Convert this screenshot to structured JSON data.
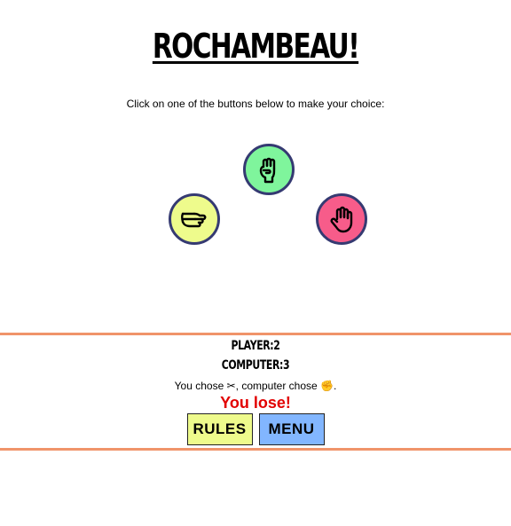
{
  "header": {
    "title": "ROCHAMBEAU!",
    "instruction": "Click on one of the buttons below to make your choice:"
  },
  "choices": {
    "rock": {
      "icon": "fist-icon",
      "color": "#7ff59c"
    },
    "scissors": {
      "icon": "scissors-hand-icon",
      "color": "#eefb8c"
    },
    "paper": {
      "icon": "open-hand-icon",
      "color": "#f75c8a"
    },
    "border_color": "#353a72"
  },
  "scoreboard": {
    "player": "PLAYER:2",
    "computer": "COMPUTER:3",
    "result_prefix": "You chose ",
    "player_choice_glyph": "✂",
    "result_middle": ", computer chose ",
    "computer_choice_glyph": "✊",
    "result_suffix": ".",
    "outcome": "You lose!",
    "outcome_color": "#e20000",
    "border_color": "#f0946a"
  },
  "buttons": {
    "rules": {
      "label": "RULES",
      "color": "#eefb8c"
    },
    "menu": {
      "label": "MENU",
      "color": "#82b6ff"
    }
  }
}
